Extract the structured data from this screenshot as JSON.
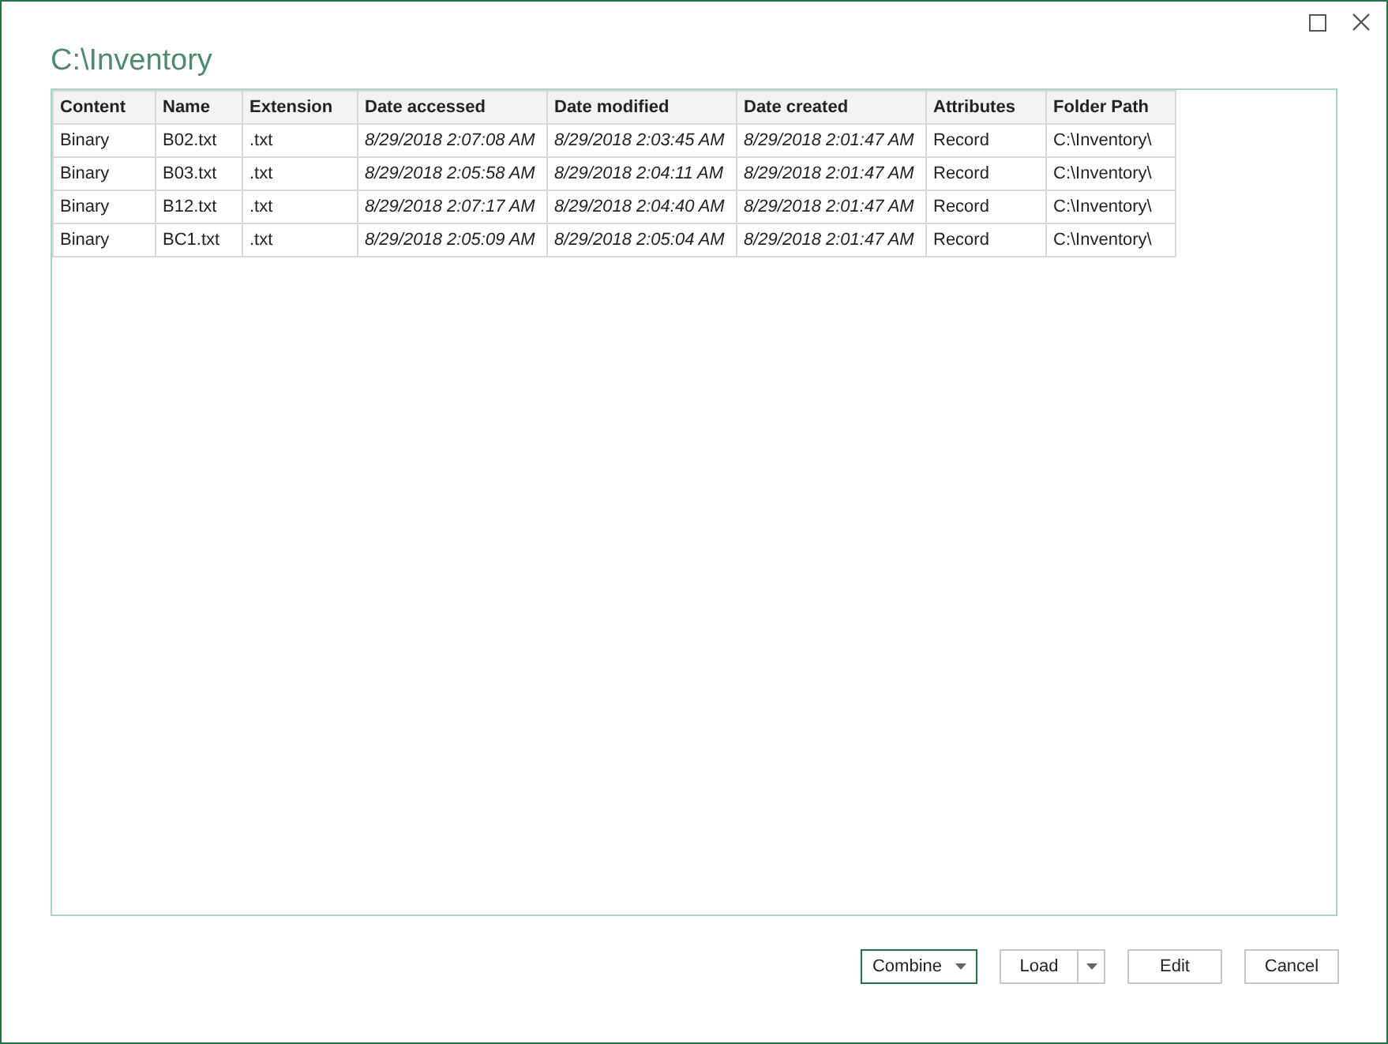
{
  "window": {
    "title": "C:\\Inventory"
  },
  "table": {
    "columns": [
      {
        "label": "Content",
        "kind": "text"
      },
      {
        "label": "Name",
        "kind": "text"
      },
      {
        "label": "Extension",
        "kind": "text"
      },
      {
        "label": "Date accessed",
        "kind": "date"
      },
      {
        "label": "Date modified",
        "kind": "date"
      },
      {
        "label": "Date created",
        "kind": "date"
      },
      {
        "label": "Attributes",
        "kind": "text"
      },
      {
        "label": "Folder Path",
        "kind": "text"
      }
    ],
    "rows": [
      [
        "Binary",
        "B02.txt",
        ".txt",
        "8/29/2018 2:07:08 AM",
        "8/29/2018 2:03:45 AM",
        "8/29/2018 2:01:47 AM",
        "Record",
        "C:\\Inventory\\"
      ],
      [
        "Binary",
        "B03.txt",
        ".txt",
        "8/29/2018 2:05:58 AM",
        "8/29/2018 2:04:11 AM",
        "8/29/2018 2:01:47 AM",
        "Record",
        "C:\\Inventory\\"
      ],
      [
        "Binary",
        "B12.txt",
        ".txt",
        "8/29/2018 2:07:17 AM",
        "8/29/2018 2:04:40 AM",
        "8/29/2018 2:01:47 AM",
        "Record",
        "C:\\Inventory\\"
      ],
      [
        "Binary",
        "BC1.txt",
        ".txt",
        "8/29/2018 2:05:09 AM",
        "8/29/2018 2:05:04 AM",
        "8/29/2018 2:01:47 AM",
        "Record",
        "C:\\Inventory\\"
      ]
    ]
  },
  "buttons": [
    {
      "label": "Combine",
      "kind": "dropdown",
      "primary": true
    },
    {
      "label": "Load",
      "kind": "split",
      "primary": false
    },
    {
      "label": "Edit",
      "kind": "plain",
      "primary": false
    },
    {
      "label": "Cancel",
      "kind": "plain",
      "primary": false
    }
  ]
}
